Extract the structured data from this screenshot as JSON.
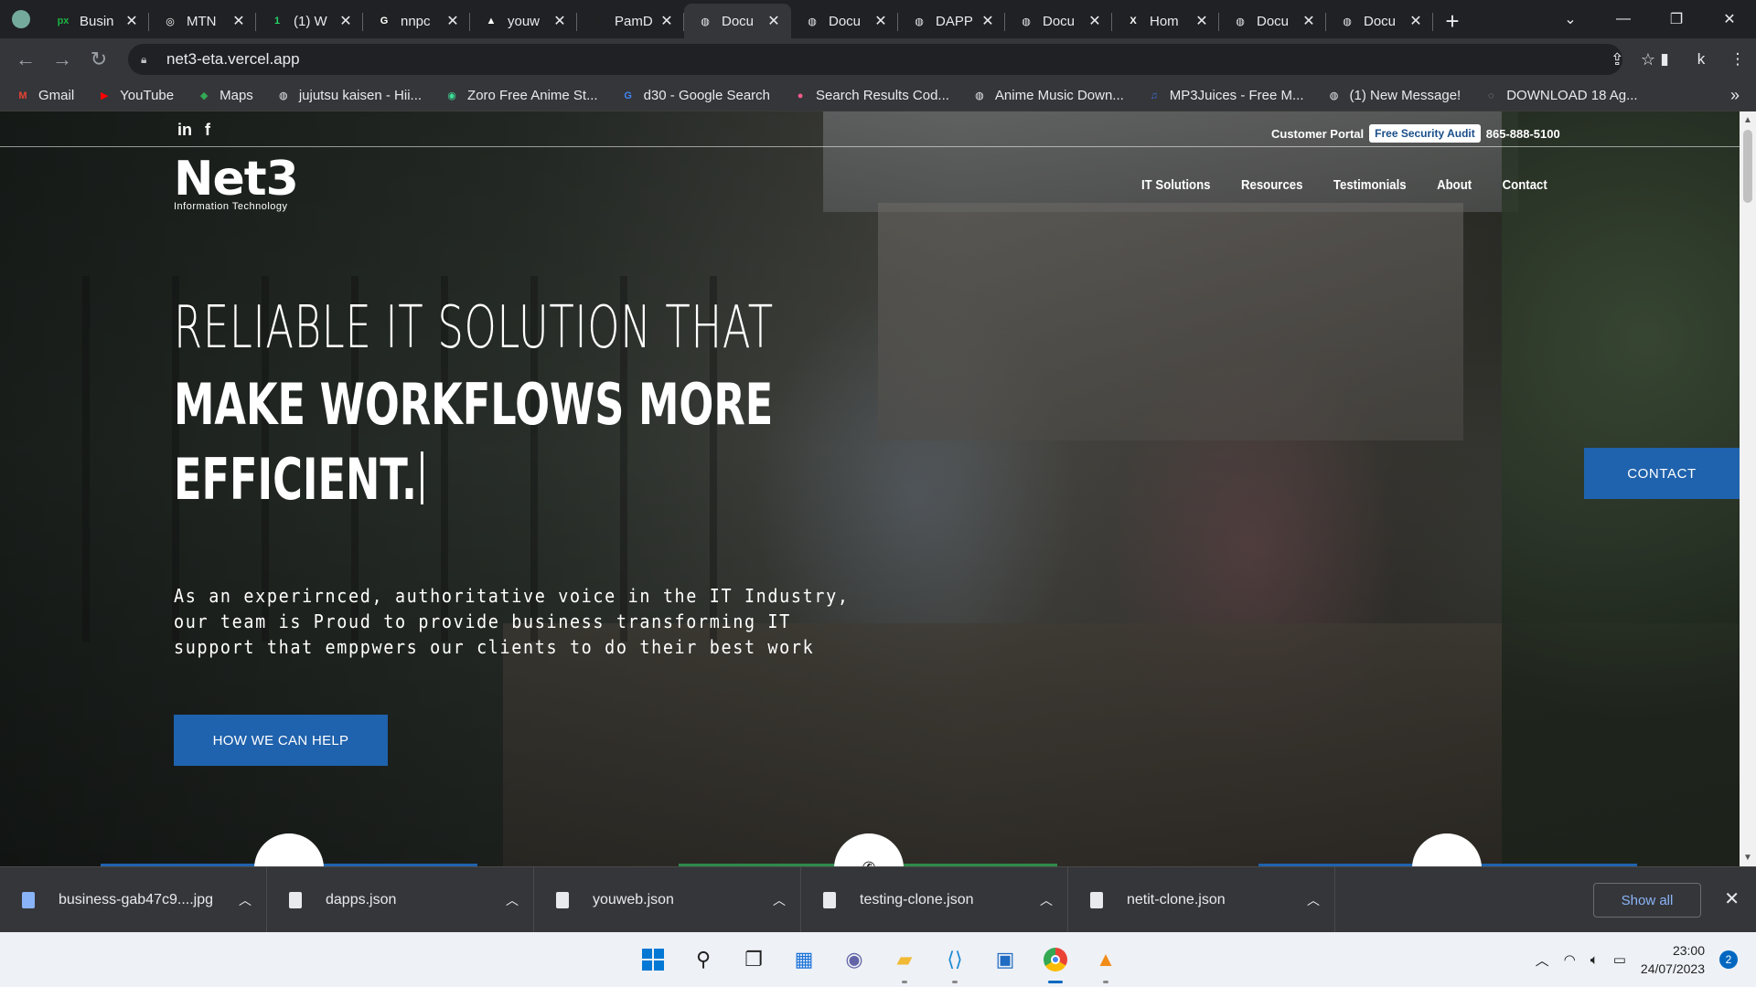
{
  "browser": {
    "tabs": [
      {
        "title": "Busin",
        "favicon_color": "#1bb343",
        "favicon_text": "px"
      },
      {
        "title": "MTN",
        "favicon_color": "#ffffff",
        "favicon_text": "◎"
      },
      {
        "title": "(1) W",
        "favicon_color": "#25d366",
        "favicon_text": "1"
      },
      {
        "title": "nnpc",
        "favicon_color": "#ffffff",
        "favicon_text": "G"
      },
      {
        "title": "youw",
        "favicon_color": "#ffffff",
        "favicon_text": "▲"
      },
      {
        "title": "PamD",
        "favicon_color": "#222222",
        "favicon_text": "P"
      },
      {
        "title": "Docu",
        "favicon_color": "#e8eaed",
        "favicon_text": "◍",
        "active": true
      },
      {
        "title": "Docu",
        "favicon_color": "#e8eaed",
        "favicon_text": "◍"
      },
      {
        "title": "DAPP",
        "favicon_color": "#e8eaed",
        "favicon_text": "◍"
      },
      {
        "title": "Docu",
        "favicon_color": "#e8eaed",
        "favicon_text": "◍"
      },
      {
        "title": "Hom",
        "favicon_color": "#ffffff",
        "favicon_text": "X"
      },
      {
        "title": "Docu",
        "favicon_color": "#e8eaed",
        "favicon_text": "◍"
      },
      {
        "title": "Docu",
        "favicon_color": "#e8eaed",
        "favicon_text": "◍"
      }
    ],
    "url": "net3-eta.vercel.app",
    "profile_letter": "k",
    "bookmarks": [
      {
        "label": "Gmail",
        "icon": "M",
        "color": "#ea4335"
      },
      {
        "label": "YouTube",
        "icon": "▶",
        "color": "#ff0000"
      },
      {
        "label": "Maps",
        "icon": "◆",
        "color": "#34a853"
      },
      {
        "label": "jujutsu kaisen - Hii...",
        "icon": "◍",
        "color": "#e8eaed"
      },
      {
        "label": "Zoro Free Anime St...",
        "icon": "◉",
        "color": "#3ddc97"
      },
      {
        "label": "d30 - Google Search",
        "icon": "G",
        "color": "#4285f4"
      },
      {
        "label": "Search Results Cod...",
        "icon": "●",
        "color": "#ff5c8a"
      },
      {
        "label": "Anime Music Down...",
        "icon": "◍",
        "color": "#e8eaed"
      },
      {
        "label": "MP3Juices - Free M...",
        "icon": "♫",
        "color": "#3b6fd4"
      },
      {
        "label": "(1) New Message!",
        "icon": "◍",
        "color": "#e8eaed"
      },
      {
        "label": "DOWNLOAD 18 Ag...",
        "icon": "◌",
        "color": "#9aa0a6"
      }
    ]
  },
  "site": {
    "social": {
      "linkedin": "in",
      "facebook": "f"
    },
    "portal_label": "Customer Portal",
    "audit_label": "Free Security Audit",
    "phone": "865-888-5100",
    "logo_mark": "Net3",
    "logo_sub": "Information Technology",
    "nav": [
      "IT Solutions",
      "Resources",
      "Testimonials",
      "About",
      "Contact"
    ],
    "hero_line1": "RELIABLE IT SOLUTION THAT",
    "hero_line2": "MAKE WORKFLOWS MORE",
    "hero_line3": "EFFICIENT.",
    "intro": "As an experirnced, authoritative voice in the IT Industry, our team is Proud to provide business transforming IT support that emppwers our clients to do their best work",
    "help_button": "HOW WE CAN HELP",
    "contact_button": "CONTACT",
    "card_strip_colors": [
      "#1f62ad",
      "#2f8a4a",
      "#1f62ad"
    ]
  },
  "downloads": {
    "items": [
      "business-gab47c9....jpg",
      "dapps.json",
      "youweb.json",
      "testing-clone.json",
      "netit-clone.json"
    ],
    "show_all": "Show all"
  },
  "taskbar": {
    "time": "23:00",
    "date": "24/07/2023",
    "notification_count": "2"
  }
}
